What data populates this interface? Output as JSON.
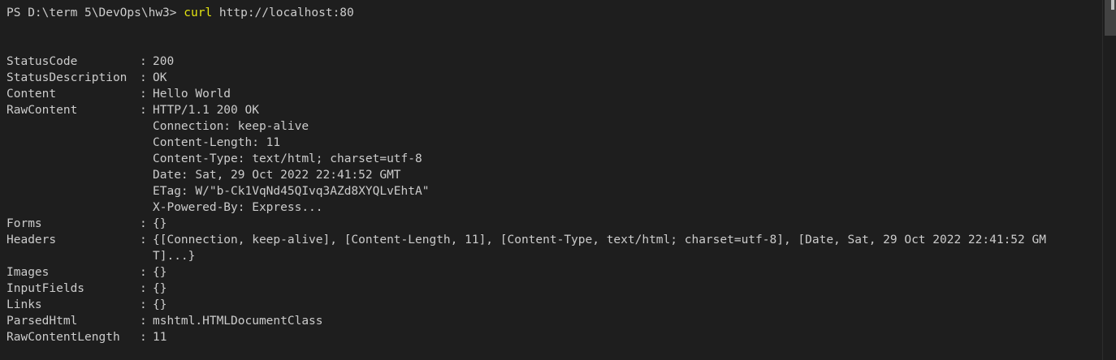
{
  "terminal": {
    "prompt": "PS D:\\term 5\\DevOps\\hw3> ",
    "command": "curl",
    "argument": " http://localhost:80"
  },
  "fields": [
    {
      "key": "StatusCode",
      "value": "200"
    },
    {
      "key": "StatusDescription",
      "value": "OK"
    },
    {
      "key": "Content",
      "value": "Hello World"
    },
    {
      "key": "RawContent",
      "value": "HTTP/1.1 200 OK"
    }
  ],
  "raw_content_lines": [
    "Connection: keep-alive",
    "Content-Length: 11",
    "Content-Type: text/html; charset=utf-8",
    "Date: Sat, 29 Oct 2022 22:41:52 GMT",
    "ETag: W/\"b-Ck1VqNd45QIvq3AZd8XYQLvEhtA\"",
    "X-Powered-By: Express..."
  ],
  "fields2": [
    {
      "key": "Forms",
      "value": "{}"
    },
    {
      "key": "Headers",
      "value": "{[Connection, keep-alive], [Content-Length, 11], [Content-Type, text/html; charset=utf-8], [Date, Sat, 29 Oct 2022 22:41:52 GM",
      "value_cont": "T]...}"
    },
    {
      "key": "Images",
      "value": "{}"
    },
    {
      "key": "InputFields",
      "value": "{}"
    },
    {
      "key": "Links",
      "value": "{}"
    },
    {
      "key": "ParsedHtml",
      "value": "mshtml.HTMLDocumentClass"
    },
    {
      "key": "RawContentLength",
      "value": "11"
    }
  ],
  "separator": ": "
}
